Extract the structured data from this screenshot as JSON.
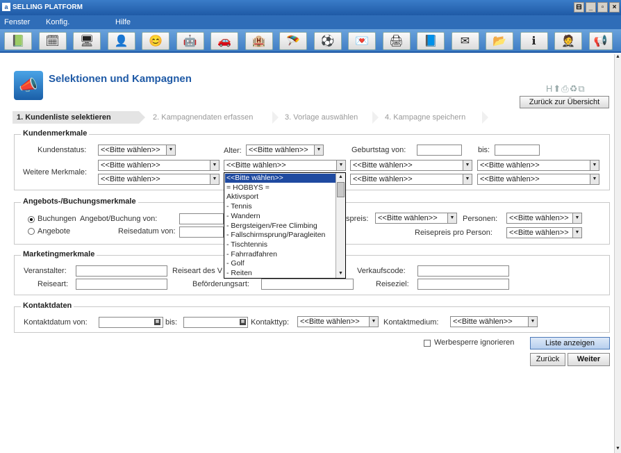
{
  "window": {
    "title": "SELLING PLATFORM",
    "controls": [
      "⊟",
      "_",
      "▫",
      "×"
    ]
  },
  "menu": {
    "items": [
      "Fenster",
      "Konfig.",
      "Hilfe"
    ]
  },
  "toolbar": {
    "icons": [
      "book-icon",
      "calendar-icon",
      "monitor-icon",
      "person-icon",
      "faces-icon",
      "robot-icon",
      "car-icon",
      "hotel-icon",
      "parachute-icon",
      "soccer-icon",
      "card-icon",
      "print-icon",
      "folder-blue-icon",
      "mail-icon",
      "folder-open-icon",
      "info-icon",
      "butler-icon",
      "megaphone-icon"
    ],
    "glyphs": [
      "📗",
      "🗓",
      "🖥",
      "👤",
      "😊",
      "🤖",
      "🚗",
      "🏨",
      "🪂",
      "⚽",
      "💌",
      "🖨",
      "📘",
      "✉",
      "📂",
      "ℹ",
      "🤵",
      "📢"
    ]
  },
  "page": {
    "title": "Selektionen und Kampagnen",
    "back_button": "Zurück zur Übersicht"
  },
  "steps": [
    "1. Kundenliste selektieren",
    "2. Kampagnendaten erfassen",
    "3. Vorlage auswählen",
    "4. Kampagne speichern"
  ],
  "kundenmerkmale": {
    "legend": "Kundenmerkmale",
    "kundenstatus_label": "Kundenstatus:",
    "kundenstatus_value": "<<Bitte wählen>>",
    "alter_label": "Alter:",
    "alter_value": "<<Bitte wählen>>",
    "geburtstag_von_label": "Geburtstag von:",
    "bis_label": "bis:",
    "weitere_label": "Weitere Merkmale:",
    "weitere_values": [
      "<<Bitte wählen>>",
      "<<Bitte wählen>>",
      "<<Bitte wählen>>",
      "<<Bitte wählen>>",
      "<<Bitte wählen>>",
      "<<Bitte wählen>>",
      "<<Bitte wählen>>",
      "<<Bitte wählen>>"
    ]
  },
  "dropdown_options": [
    "<<Bitte wählen>>",
    "= HOBBYS =",
    "Aktivsport",
    "- Tennis",
    "- Wandern",
    "- Bergsteigen/Free Climbing",
    "- Fallschirmsprung/Paragleiten",
    "- Tischtennis",
    "- Fahrradfahren",
    "- Golf",
    "- Reiten"
  ],
  "angebote": {
    "legend": "Angebots-/Buchungsmerkmale",
    "radio_buchungen": "Buchungen",
    "radio_angebote": "Angebote",
    "angebot_von_label": "Angebot/Buchung von:",
    "reisedatum_von_label": "Reisedatum von:",
    "reisepreis_label": "spreis:",
    "reisepreis_value": "<<Bitte wählen>>",
    "personen_label": "Personen:",
    "personen_value": "<<Bitte wählen>>",
    "reisepreis_person_label": "Reisepreis pro Person:",
    "reisepreis_person_value": "<<Bitte wählen>>"
  },
  "marketing": {
    "legend": "Marketingmerkmale",
    "veranstalter_label": "Veranstalter:",
    "reiseart_des_label": "Reiseart des V",
    "verkaufscode_label": "Verkaufscode:",
    "reiseart_label": "Reiseart:",
    "befoerderung_label": "Beförderungsart:",
    "reiseziel_label": "Reiseziel:"
  },
  "kontakt": {
    "legend": "Kontaktdaten",
    "datum_von_label": "Kontaktdatum von:",
    "bis_label": "bis:",
    "typ_label": "Kontakttyp:",
    "typ_value": "<<Bitte wählen>>",
    "medium_label": "Kontaktmedium:",
    "medium_value": "<<Bitte wählen>>"
  },
  "footer": {
    "werbesperre_label": "Werbesperre ignorieren",
    "liste_button": "Liste anzeigen",
    "zurueck_button": "Zurück",
    "weiter_button": "Weiter"
  }
}
